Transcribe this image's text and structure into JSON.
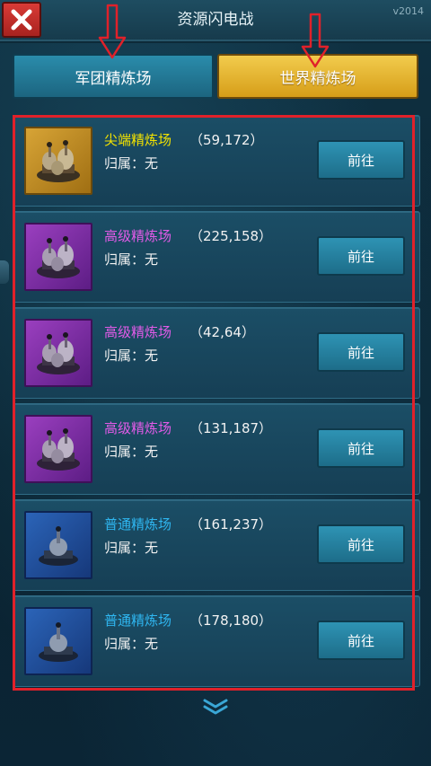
{
  "header": {
    "title": "资源闪电战",
    "version": "v2014",
    "close_icon": "close-x-icon"
  },
  "tabs": [
    {
      "label": "军团精炼场",
      "active": false
    },
    {
      "label": "世界精炼场",
      "active": true
    }
  ],
  "annotation_colors": {
    "highlight": "#e0212a"
  },
  "refineries": [
    {
      "name": "尖端精炼场",
      "name_color": "#f3e300",
      "coords": "（59,172）",
      "owner": "归属：无",
      "button": "前往",
      "tier": "gold"
    },
    {
      "name": "高级精炼场",
      "name_color": "#e25be8",
      "coords": "（225,158）",
      "owner": "归属：无",
      "button": "前往",
      "tier": "purple"
    },
    {
      "name": "高级精炼场",
      "name_color": "#e25be8",
      "coords": "（42,64）",
      "owner": "归属：无",
      "button": "前往",
      "tier": "purple"
    },
    {
      "name": "高级精炼场",
      "name_color": "#e25be8",
      "coords": "（131,187）",
      "owner": "归属：无",
      "button": "前往",
      "tier": "purple"
    },
    {
      "name": "普通精炼场",
      "name_color": "#2fb6f0",
      "coords": "（161,237）",
      "owner": "归属：无",
      "button": "前往",
      "tier": "blue"
    },
    {
      "name": "普通精炼场",
      "name_color": "#2fb6f0",
      "coords": "（178,180）",
      "owner": "归属：无",
      "button": "前往",
      "tier": "blue"
    }
  ],
  "scroll_icon": "double-chevron-down-icon"
}
